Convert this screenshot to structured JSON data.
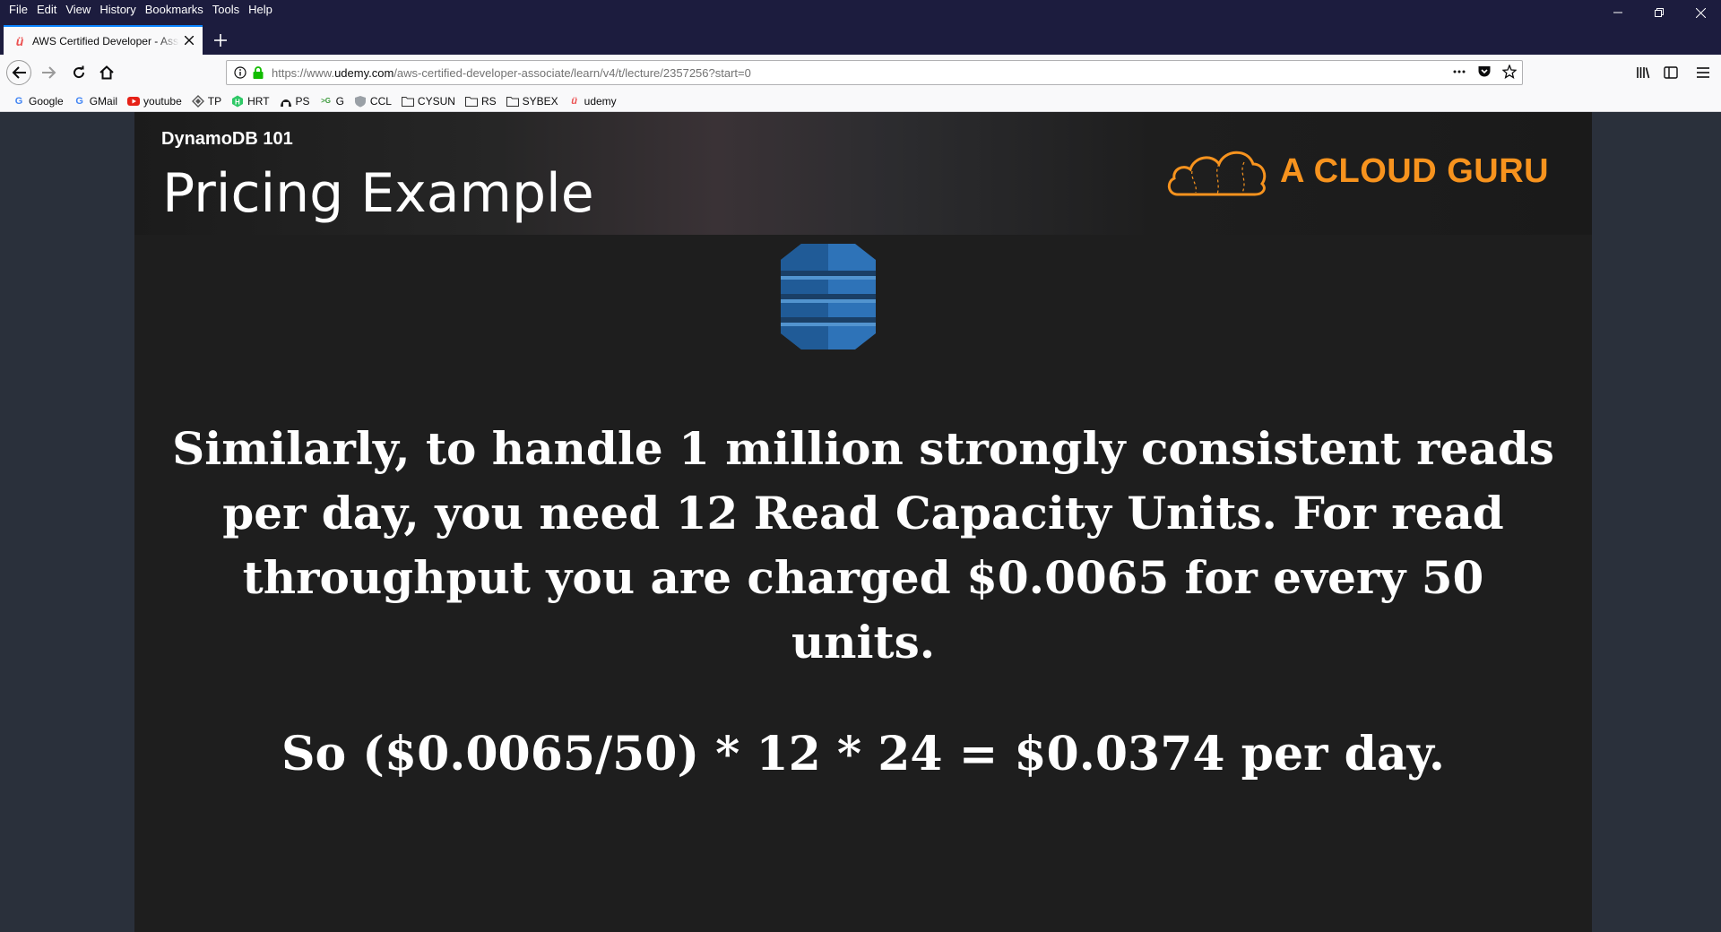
{
  "menu": [
    "File",
    "Edit",
    "View",
    "History",
    "Bookmarks",
    "Tools",
    "Help"
  ],
  "tab": {
    "title": "AWS Certified Developer - Associate",
    "favicon": "udemy-icon"
  },
  "url": {
    "prefix": "https://www.",
    "domain": "udemy.com",
    "path": "/aws-certified-developer-associate/learn/v4/t/lecture/2357256?start=0"
  },
  "bookmarks": [
    {
      "label": "Google",
      "icon": "google-icon"
    },
    {
      "label": "GMail",
      "icon": "google-icon"
    },
    {
      "label": "youtube",
      "icon": "youtube-icon"
    },
    {
      "label": "TP",
      "icon": "tp-icon"
    },
    {
      "label": "HRT",
      "icon": "hackerrank-icon"
    },
    {
      "label": "PS",
      "icon": "ps-icon"
    },
    {
      "label": "G",
      "icon": "g-icon"
    },
    {
      "label": "CCL",
      "icon": "ccl-icon"
    },
    {
      "label": "CYSUN",
      "icon": "folder-icon"
    },
    {
      "label": "RS",
      "icon": "folder-icon"
    },
    {
      "label": "SYBEX",
      "icon": "folder-icon"
    },
    {
      "label": "udemy",
      "icon": "udemy-icon"
    }
  ],
  "slide": {
    "course": "DynamoDB 101",
    "title": "Pricing Example",
    "brand": "A CLOUD GURU",
    "body": "Similarly, to handle 1 million strongly consistent reads per day, you need 12 Read Capacity Units. For read throughput you are charged $0.0065 for every 50 units.",
    "formula": "So ($0.0065/50)  * 12 * 24 = $0.0374 per day."
  },
  "colors": {
    "accent": "#f7931e",
    "tab_highlight": "#0a84ff",
    "titlebar": "#1c1c3e",
    "dynamo_blue": "#2e73b8"
  }
}
